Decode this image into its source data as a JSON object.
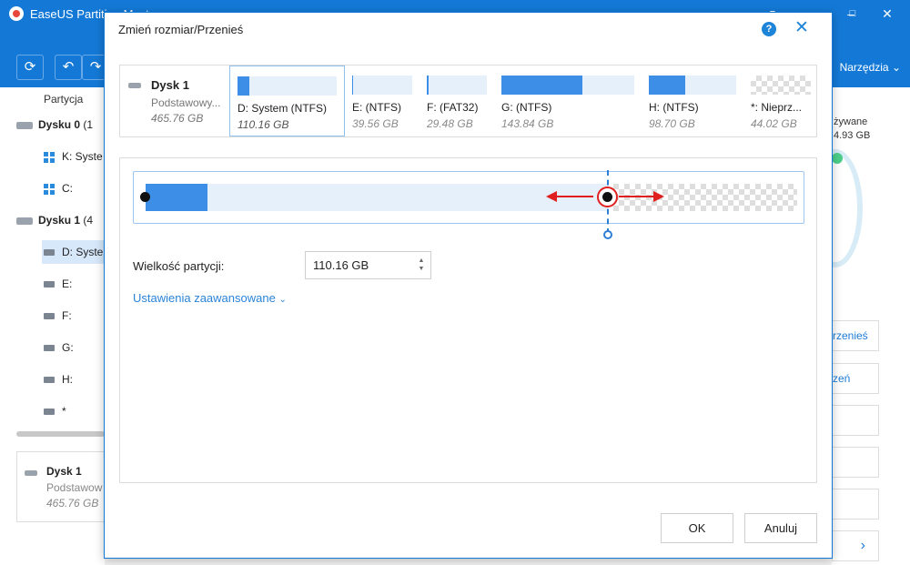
{
  "app": {
    "title": "EaseUS Partition Master",
    "tools_label": "Narzędzia",
    "partition_column": "Partycja"
  },
  "tree": [
    {
      "label": "Dysku 0",
      "suffix": "(1"
    },
    {
      "label": "K: Syste"
    },
    {
      "label": "C:"
    },
    {
      "label": "Dysku 1",
      "suffix": "(4"
    },
    {
      "label": "D: Syste"
    },
    {
      "label": "E:"
    },
    {
      "label": "F:"
    },
    {
      "label": "G:"
    },
    {
      "label": "H:"
    },
    {
      "label": "*"
    }
  ],
  "disk_card": {
    "name": "Dysk 1",
    "type": "Podstawow",
    "size": "465.76 GB"
  },
  "right_panel": {
    "used_label": "żywane",
    "used_value": "4.93 GB",
    "btn_move": "rzenieś",
    "btn_settings": "zeń",
    "more_icon": "›"
  },
  "dialog": {
    "title": "Zmień rozmiar/Przenieś",
    "disk": {
      "name": "Dysk 1",
      "type": "Podstawowy...",
      "size": "465.76 GB"
    },
    "partitions": [
      {
        "label": "D: System (NTFS)",
        "size": "110.16 GB",
        "fill": 0.12,
        "selected": true
      },
      {
        "label": "E:  (NTFS)",
        "size": "39.56 GB",
        "fill": 0.02
      },
      {
        "label": "F:  (FAT32)",
        "size": "29.48 GB",
        "fill": 0.03
      },
      {
        "label": "G:  (NTFS)",
        "size": "143.84 GB",
        "fill": 0.61
      },
      {
        "label": "H:  (NTFS)",
        "size": "98.70 GB",
        "fill": 0.42
      },
      {
        "label": "*: Nieprz...",
        "size": "44.02 GB",
        "unallocated": true
      }
    ],
    "partition_size_label": "Wielkość partycji:",
    "partition_size_value": "110.16 GB",
    "advanced_label": "Ustawienia zaawansowane",
    "ok_label": "OK",
    "cancel_label": "Anuluj",
    "colors": {
      "accent": "#1479d6",
      "fill": "#3d8ee6",
      "arrow": "#e0201e"
    }
  }
}
